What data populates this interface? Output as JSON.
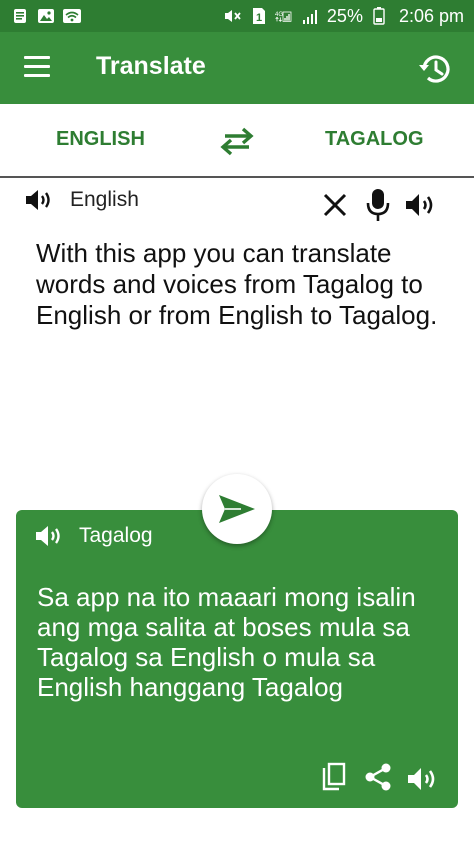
{
  "status_bar": {
    "battery": "25%",
    "time": "2:06 pm",
    "sim_number": "1",
    "network": "4G"
  },
  "app_bar": {
    "title": "Translate"
  },
  "languages": {
    "source": "ENGLISH",
    "target": "TAGALOG"
  },
  "input": {
    "language_label": "English",
    "text": "With this app you can translate words and voices from Tagalog to English or from English to Tagalog."
  },
  "output": {
    "language_label": "Tagalog",
    "text": "Sa app na ito maaari mong isalin ang mga salita at boses mula sa Tagalog sa English o mula sa English hanggang Tagalog"
  },
  "colors": {
    "primary": "#388e3c",
    "primary_dark": "#2e7d32",
    "text_dark": "#111111",
    "white": "#ffffff"
  },
  "icons": {
    "menu": "menu-icon",
    "history": "history-icon",
    "swap": "swap-icon",
    "speaker": "speaker-icon",
    "clear": "close-icon",
    "mic": "microphone-icon",
    "send": "send-icon",
    "copy": "copy-icon",
    "share": "share-icon"
  }
}
